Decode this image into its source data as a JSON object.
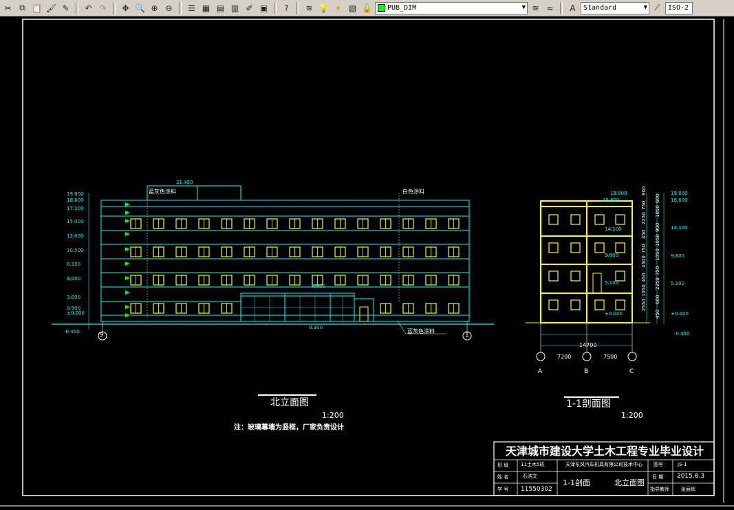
{
  "toolbar": {
    "layer_name": "PUB_DIM",
    "text_style": "Standard",
    "dim_style": "ISO-2"
  },
  "drawing": {
    "elevation": {
      "title": "北立面图",
      "scale": "1:200",
      "note": "注：玻璃幕墙为竖框，厂家负责设计",
      "roof_level": "21.450",
      "levels_left": [
        "19.800",
        "18.600",
        "17.100",
        "15.000",
        "12.600",
        "10.500",
        "8.100",
        "6.000",
        "3.000",
        "0.900",
        "±0.000",
        "-0.450"
      ],
      "label_top_left": "蓝灰色涂料",
      "label_top_right": "白色涂料",
      "label_bottom": "蓝灰色涂料",
      "canopy_level": "4.800",
      "ground_level": "0.300",
      "axis_left": "9",
      "axis_right": "1"
    },
    "section": {
      "title": "1-1剖面图",
      "scale": "1:200",
      "levels_right": [
        "19.800",
        "18.600",
        "14.100",
        "9.800",
        "5.100",
        "±0.000",
        "-0.450"
      ],
      "levels_left": [
        "19.800",
        "18.600"
      ],
      "inner_levels": [
        "14.100",
        "9.800",
        "5.100",
        "±0.000"
      ],
      "dims_vertical": [
        "900",
        "600",
        "750",
        "1050",
        "2250",
        "900",
        "450",
        "1050",
        "750",
        "1050",
        "4500",
        "750",
        "450",
        "2250",
        "1050",
        "600",
        "2550",
        "450"
      ],
      "total_width": "14700",
      "bay_widths": [
        "7200",
        "7500"
      ],
      "axes": [
        "A",
        "B",
        "C"
      ]
    },
    "title_block": {
      "heading": "天津城市建设大学土木工程专业毕业设计",
      "class_label": "班 级",
      "class_value": "11土木5班",
      "project": "天津东风汽车机具有限公司技术中心",
      "name_label": "姓 名",
      "name_value": "石浩文",
      "id_label": "学 号",
      "id_value": "11550302",
      "drawing_name_1": "1-1剖面",
      "drawing_name_2": "北立面图",
      "sheet_label": "图号",
      "sheet_value": "JS-1",
      "date_label": "日 期",
      "date_value": "2015.6.3",
      "advisor_label": "指导教师",
      "advisor_value": "张丽辉"
    }
  }
}
